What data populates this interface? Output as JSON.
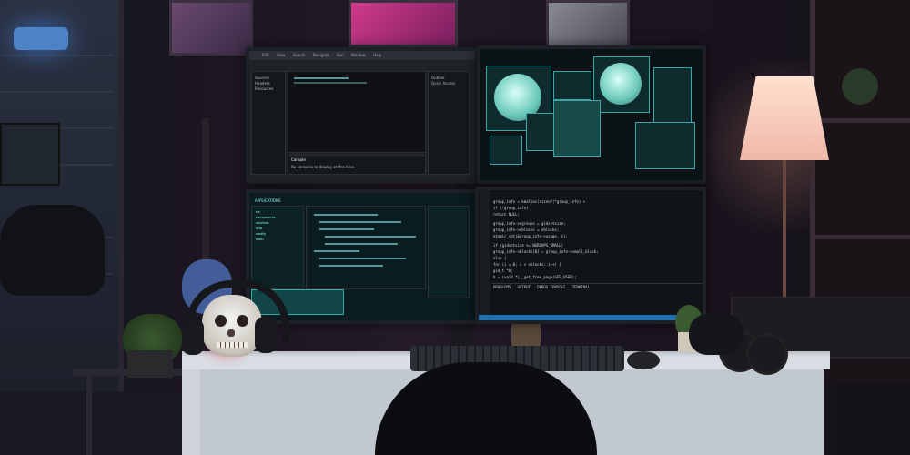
{
  "scene": {
    "description_type": "photograph",
    "accent_colors": {
      "window_light": "#5da8ff",
      "poster_pink": "#d03a8a",
      "lamp_warm": "#ffb090",
      "screen_teal": "#3aa8a8",
      "skull_glow": "#ff2a40"
    }
  },
  "monitor_top_left": {
    "menu_items": [
      "Edit",
      "View",
      "Search",
      "Navigate",
      "Run",
      "Window",
      "Help"
    ],
    "explorer_items": [
      "Sources",
      "Headers",
      "Resources"
    ],
    "outline_items": [
      "Outline",
      "Quick Access"
    ],
    "console_tab": "Console",
    "console_text": "No consoles to display at this time."
  },
  "monitor_bottom_left": {
    "explorer_title": "APPLICATIONS",
    "tree_items": [
      "src",
      "components",
      "services",
      "utils",
      "config",
      "main"
    ]
  },
  "monitor_bottom_right": {
    "tabs": [
      "PROBLEMS",
      "OUTPUT",
      "DEBUG CONSOLE",
      "TERMINAL"
    ],
    "code_lines": [
      "group_info = kmalloc(sizeof(*group_info) +",
      "if (!group_info)",
      "    return NULL;",
      "group_info->ngroups = gidsetsize;",
      "group_info->nblocks = nblocks;",
      "atomic_set(&group_info->usage, 1);",
      "if (gidsetsize <= NGROUPS_SMALL)",
      "    group_info->blocks[0] = group_info->small_block;",
      "else {",
      "    for (i = 0; i < nblocks; i++) {",
      "        gid_t *b;",
      "        b = (void *)__get_free_page(GFP_USER);"
    ]
  },
  "icons": [
    "globe-visual",
    "code-window",
    "terminal-panel"
  ]
}
